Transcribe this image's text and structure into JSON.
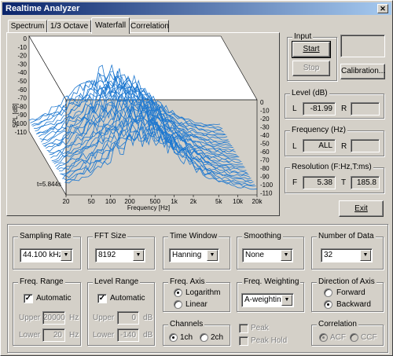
{
  "window": {
    "title": "Realtime Analyzer"
  },
  "tabs": [
    {
      "label": "Spectrum"
    },
    {
      "label": "1/3 Octave"
    },
    {
      "label": "Waterfall"
    },
    {
      "label": "Correlation"
    }
  ],
  "plot": {
    "ylabel": "SPL [dB]",
    "yticks": [
      "0",
      "-10",
      "-20",
      "-30",
      "-40",
      "-50",
      "-60",
      "-70",
      "-80",
      "-90",
      "-100",
      "-110"
    ],
    "zticks": [
      "0",
      "-10",
      "-20",
      "-30",
      "-40",
      "-50",
      "-60",
      "-70",
      "-80",
      "-90",
      "-100",
      "-110"
    ],
    "xticks": [
      "20",
      "50",
      "100",
      "200",
      "500",
      "1k",
      "2k",
      "5k",
      "10k",
      "20k"
    ],
    "xlabel": "Frequency  [Hz]",
    "time": "t=5.844s",
    "color": "#1e78d0"
  },
  "input": {
    "label": "Input",
    "start": "Start",
    "stop": "Stop",
    "calibration": "Calibration..."
  },
  "level": {
    "label": "Level (dB)",
    "l": "L",
    "l_value": "-81.99",
    "r": "R",
    "r_value": ""
  },
  "frequency": {
    "label": "Frequency (Hz)",
    "l": "L",
    "l_value": "ALL",
    "r": "R",
    "r_value": ""
  },
  "resolution": {
    "label": "Resolution (F:Hz,T:ms)",
    "f": "F",
    "f_value": "5.38",
    "t": "T",
    "t_value": "185.8"
  },
  "exit": "Exit",
  "sampling_rate": {
    "label": "Sampling Rate",
    "value": "44.100 kHz"
  },
  "fft_size": {
    "label": "FFT Size",
    "value": "8192"
  },
  "time_window": {
    "label": "Time Window",
    "value": "Hanning"
  },
  "smoothing": {
    "label": "Smoothing",
    "value": "None"
  },
  "number_of_data": {
    "label": "Number of Data",
    "value": "32"
  },
  "freq_range": {
    "label": "Freq. Range",
    "automatic": "Automatic",
    "upper": "Upper",
    "upper_value": "20000",
    "upper_unit": "Hz",
    "lower": "Lower",
    "lower_value": "20",
    "lower_unit": "Hz"
  },
  "level_range": {
    "label": "Level Range",
    "automatic": "Automatic",
    "upper": "Upper",
    "upper_value": "0",
    "upper_unit": "dB",
    "lower": "Lower",
    "lower_value": "-140",
    "lower_unit": "dB"
  },
  "freq_axis": {
    "label": "Freq. Axis",
    "logarithm": "Logarithm",
    "linear": "Linear"
  },
  "channels": {
    "label": "Channels",
    "ch1": "1ch",
    "ch2": "2ch"
  },
  "freq_weighting": {
    "label": "Freq. Weighting",
    "value": "A-weighting",
    "peak": "Peak",
    "peak_hold": "Peak Hold"
  },
  "direction": {
    "label": "Direction of Axis",
    "forward": "Forward",
    "backward": "Backward"
  },
  "correlation": {
    "label": "Correlation",
    "acf": "ACF",
    "ccf": "CCF"
  }
}
